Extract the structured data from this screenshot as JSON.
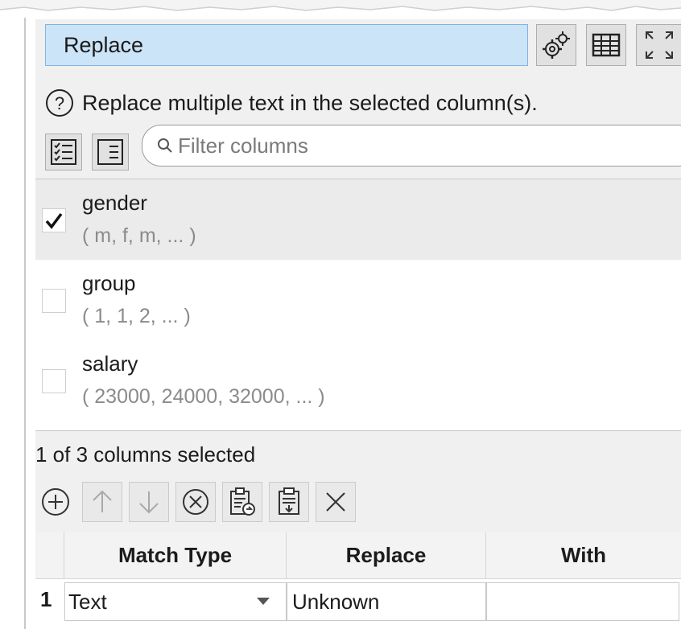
{
  "panel": {
    "title": "Replace",
    "toolbar_icons": [
      "gears-icon",
      "table-icon",
      "expand-icon"
    ]
  },
  "help": {
    "text": "Replace multiple text in the selected column(s)."
  },
  "filter": {
    "placeholder": "Filter columns",
    "value": ""
  },
  "columns": [
    {
      "name": "gender",
      "sample": "( m, f, m, ... )",
      "checked": true
    },
    {
      "name": "group",
      "sample": "( 1, 1, 2, ... )",
      "checked": false
    },
    {
      "name": "salary",
      "sample": "( 23000, 24000, 32000, ... )",
      "checked": false
    }
  ],
  "status": "1 of 3 columns selected",
  "action_icons": [
    "add-icon",
    "up-arrow-icon",
    "down-arrow-icon",
    "remove-icon",
    "paste-icon",
    "copy-icon",
    "clear-icon"
  ],
  "table": {
    "headers": [
      "Match Type",
      "Replace",
      "With"
    ],
    "rows": [
      {
        "num": "1",
        "match_type": "Text",
        "replace": "Unknown",
        "with": ""
      }
    ]
  },
  "colors": {
    "title_bg": "#cce4f7",
    "title_border": "#7eb4ea",
    "panel_bg": "#f0f0f0",
    "selected_row_bg": "#ebebeb"
  }
}
